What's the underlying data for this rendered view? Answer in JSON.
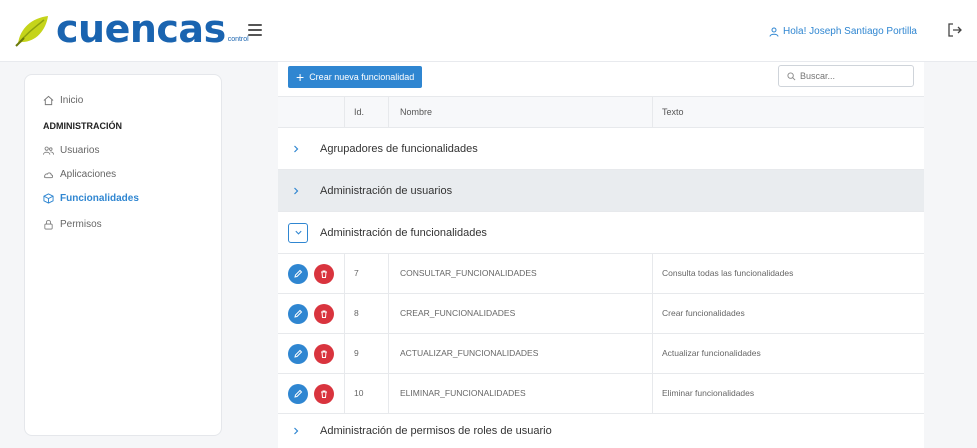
{
  "app": {
    "logo_text": "cuencas",
    "logo_sub": "control"
  },
  "header": {
    "greeting": "Hola! Joseph Santiago Portilla"
  },
  "sidebar": {
    "inicio": "Inicio",
    "section": "ADMINISTRACIÓN",
    "items": [
      {
        "label": "Usuarios",
        "icon": "users-icon"
      },
      {
        "label": "Aplicaciones",
        "icon": "cloud-icon"
      },
      {
        "label": "Funcionalidades",
        "icon": "box-icon",
        "active": true
      },
      {
        "label": "Permisos",
        "icon": "lock-icon"
      }
    ]
  },
  "toolbar": {
    "new_label": "Crear nueva funcionalidad",
    "search_placeholder": "Buscar..."
  },
  "table": {
    "headers": {
      "id": "Id.",
      "nombre": "Nombre",
      "texto": "Texto"
    },
    "groups": [
      "Agrupadores de funcionalidades",
      "Administración de usuarios",
      "Administración de funcionalidades",
      "Administración de permisos de roles de usuario"
    ],
    "rows": [
      {
        "id": "7",
        "nombre": "CONSULTAR_FUNCIONALIDADES",
        "texto": "Consulta todas las funcionalidades"
      },
      {
        "id": "8",
        "nombre": "CREAR_FUNCIONALIDADES",
        "texto": "Crear funcionalidades"
      },
      {
        "id": "9",
        "nombre": "ACTUALIZAR_FUNCIONALIDADES",
        "texto": "Actualizar funcionalidades"
      },
      {
        "id": "10",
        "nombre": "ELIMINAR_FUNCIONALIDADES",
        "texto": "Eliminar funcionalidades"
      }
    ]
  },
  "colors": {
    "primary": "#2f86d1",
    "danger": "#d9343e",
    "brand": "#1a64b0",
    "leaf": "#c5d41a"
  }
}
